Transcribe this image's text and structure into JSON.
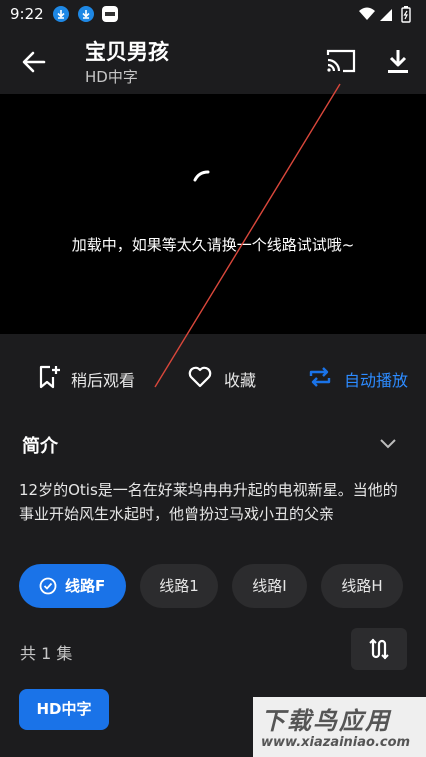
{
  "status_bar": {
    "time": "9:22"
  },
  "header": {
    "title": "宝贝男孩",
    "subtitle": "HD中字"
  },
  "player": {
    "loading_text": "加载中，如果等太久请换一个线路试试哦~"
  },
  "actions": {
    "watch_later": "稍后观看",
    "favorite": "收藏",
    "autoplay": "自动播放"
  },
  "intro": {
    "title": "简介",
    "text": "12岁的Otis是一名在好莱坞冉冉升起的电视新星。当他的事业开始风生水起时，他曾扮过马戏小丑的父亲"
  },
  "lines": [
    {
      "label": "线路F",
      "active": true
    },
    {
      "label": "线路1",
      "active": false
    },
    {
      "label": "线路I",
      "active": false
    },
    {
      "label": "线路H",
      "active": false
    }
  ],
  "episodes": {
    "count_text": "共 1 集",
    "items": [
      "HD中字"
    ]
  },
  "watermark": {
    "text": "下载鸟应用",
    "url": "www.xiazainiao.com"
  },
  "colors": {
    "accent": "#1a73e8",
    "background": "#1c1c1e",
    "annotation": "#d9473b"
  }
}
